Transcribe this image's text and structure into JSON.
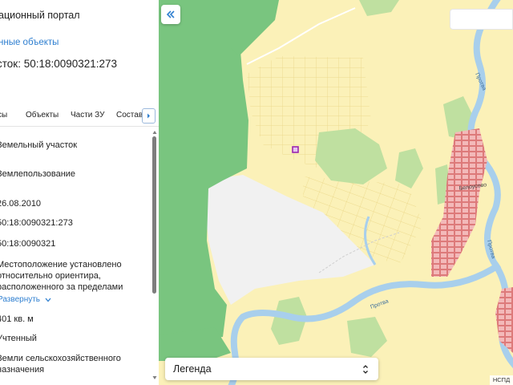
{
  "panel": {
    "portal_title": "ационный портал",
    "back_link": "нные объекты",
    "plot_title": "сток: 50:18:0090321:273",
    "tabs": [
      "сы",
      "Объекты",
      "Части ЗУ",
      "Состав"
    ],
    "fields": [
      "Земельный участок",
      "Землепользование",
      "26.08.2010",
      "50:18:0090321:273",
      "50:18:0090321",
      "Местоположение установлено",
      "относительно ориентира,",
      "расположенного за пределами",
      "401 кв. м",
      "Учтенный",
      "Земли сельскохозяйственного",
      "назначения"
    ],
    "expand_label": "Развернуть"
  },
  "map": {
    "legend_label": "Легенда",
    "attribution": "НСПД",
    "labels": {
      "river_1": "Протва",
      "river_2": "Протва",
      "river_3": "Протва",
      "village": "Белоусово"
    }
  },
  "colors": {
    "forest": "#79c57f",
    "land": "#fbf1b8",
    "river": "#a8cfec",
    "empty": "#f1f1f1",
    "buildings": "#f3b9b9",
    "link": "#2f7fd0",
    "selected_plot": "#9c27b0"
  },
  "icons": [
    "chevron-right-icon",
    "chevron-down-icon",
    "double-chevron-left-icon",
    "updown-chevron-icon"
  ]
}
